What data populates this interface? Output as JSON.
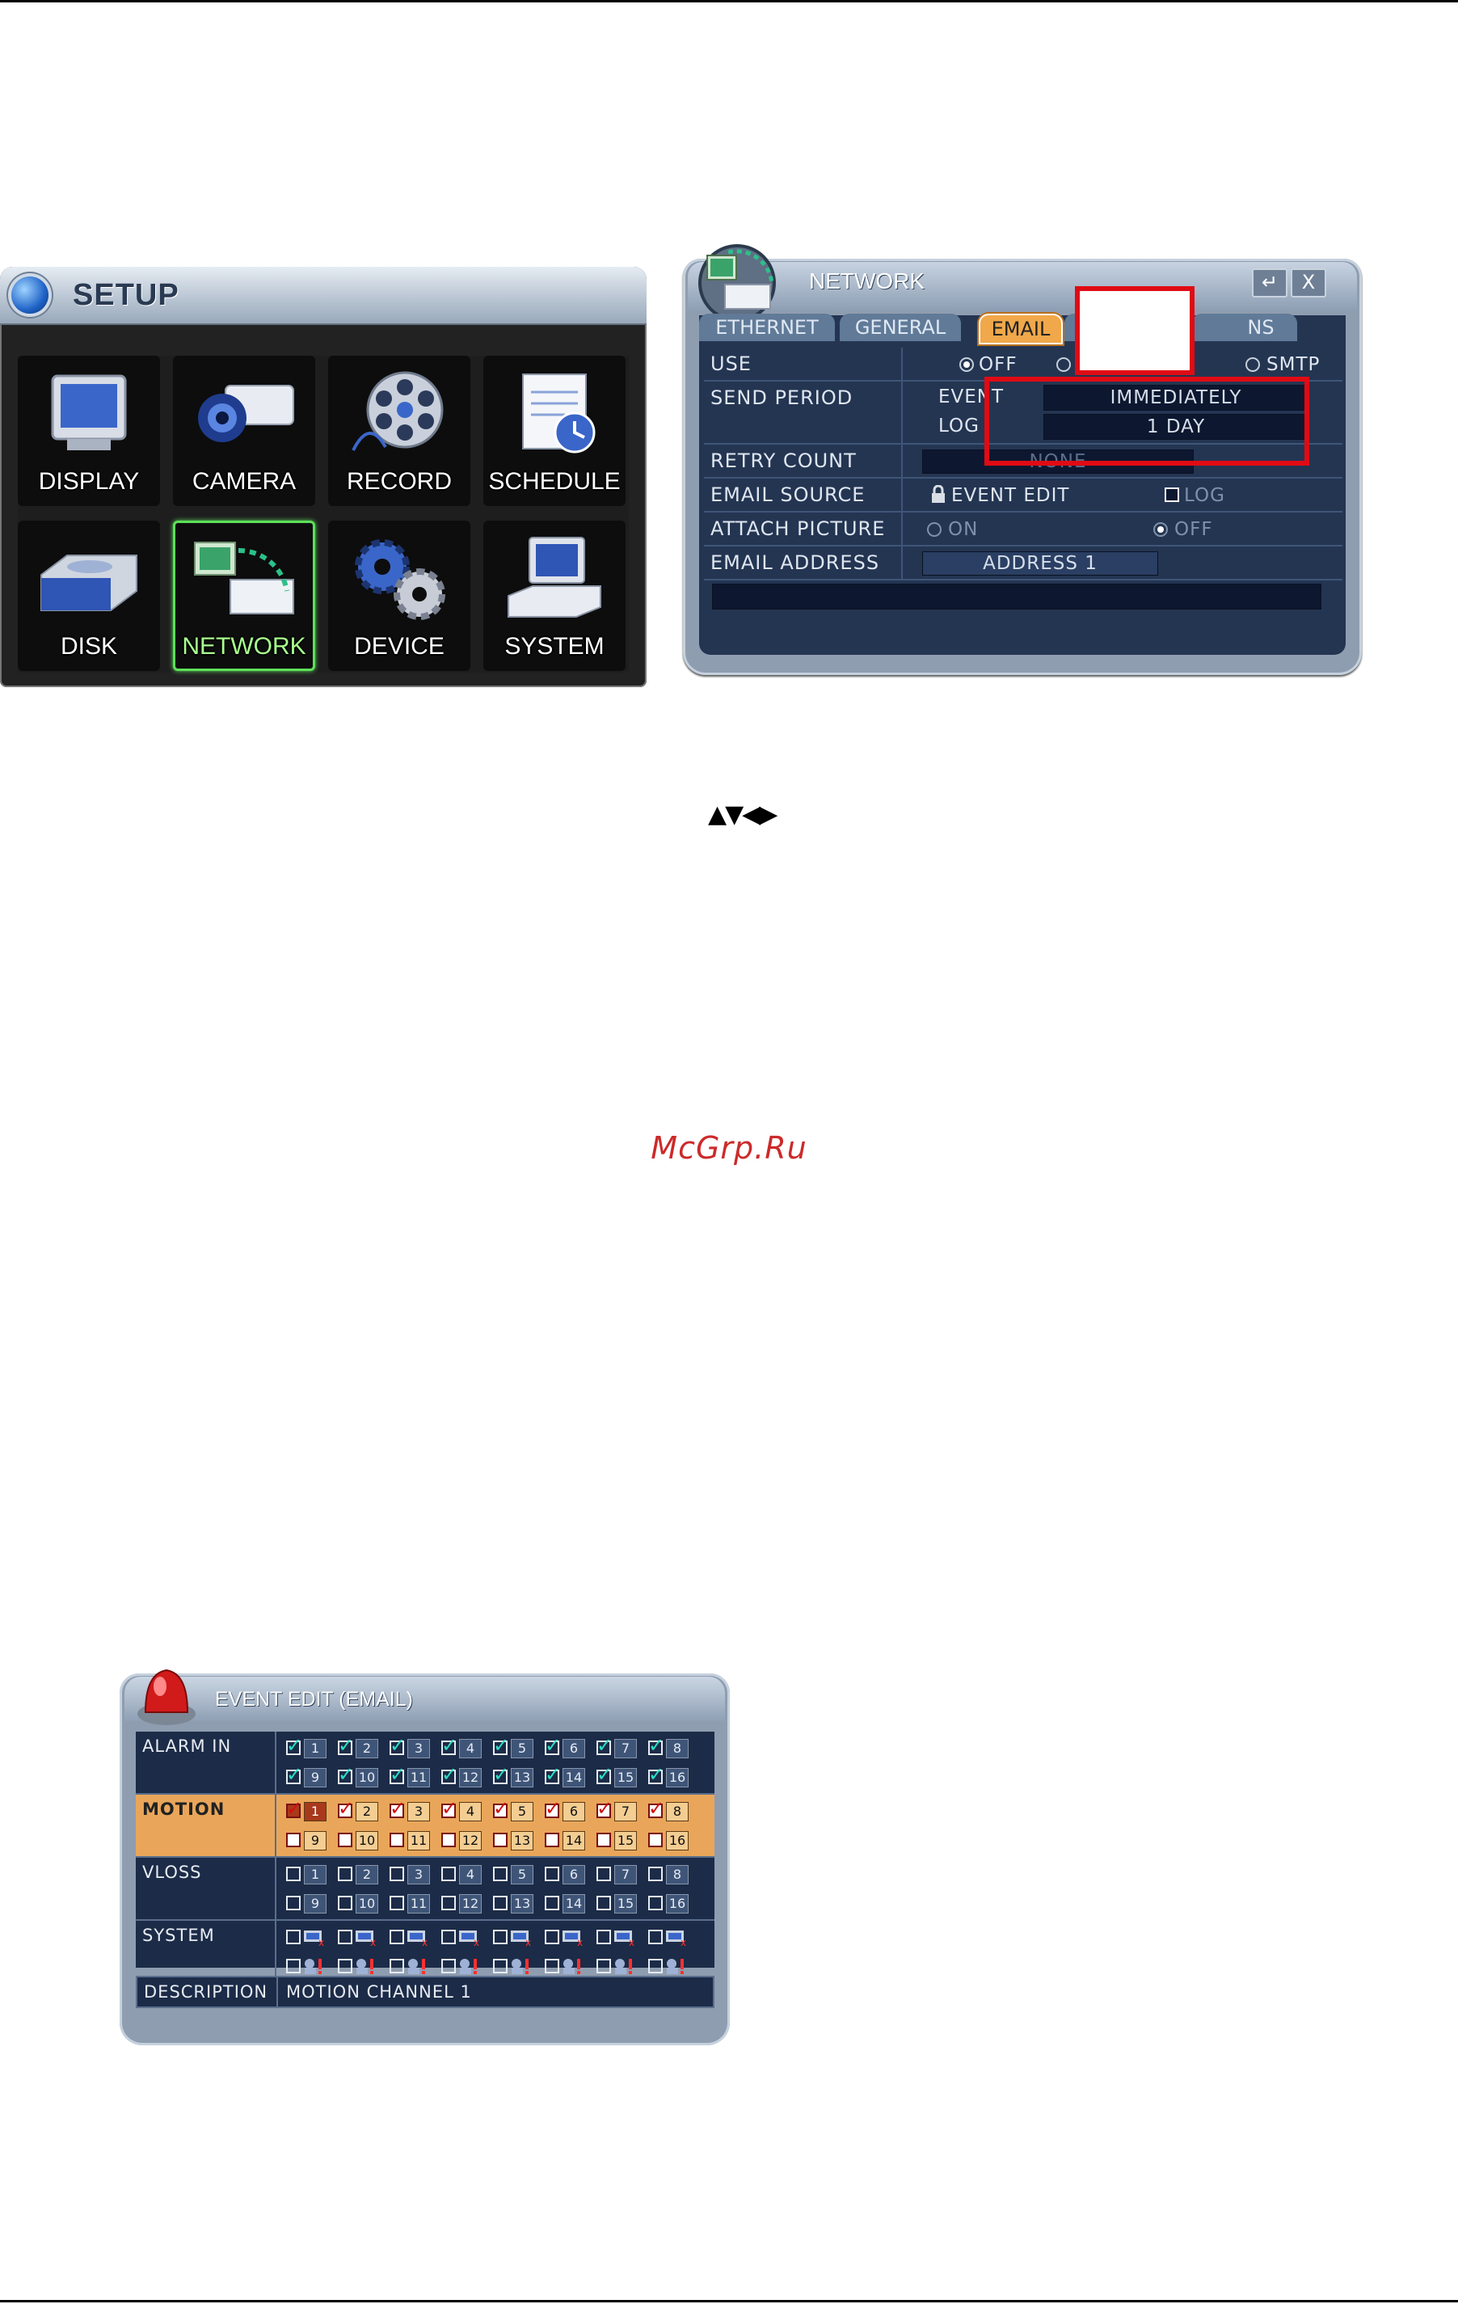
{
  "setup": {
    "title": "SETUP",
    "tiles": [
      {
        "label": "DISPLAY",
        "icon": "monitor-icon"
      },
      {
        "label": "CAMERA",
        "icon": "camera-icon"
      },
      {
        "label": "RECORD",
        "icon": "film-reel-icon"
      },
      {
        "label": "SCHEDULE",
        "icon": "notepad-clock-icon"
      },
      {
        "label": "DISK",
        "icon": "hard-disk-icon"
      },
      {
        "label": "NETWORK",
        "icon": "network-computers-icon",
        "selected": true
      },
      {
        "label": "DEVICE",
        "icon": "gears-icon"
      },
      {
        "label": "SYSTEM",
        "icon": "computer-icon"
      }
    ]
  },
  "network": {
    "title": "NETWORK",
    "tabs": [
      "ETHERNET",
      "GENERAL",
      "EMAIL",
      "NS"
    ],
    "active_tab": "EMAIL",
    "buttons": {
      "enter": "↵",
      "close": "X"
    },
    "use": {
      "label": "USE",
      "off": "OFF",
      "smtp": "SMTP"
    },
    "send_period": {
      "label": "SEND PERIOD",
      "event_label": "EVENT",
      "event_value": "IMMEDIATELY",
      "log_label": "LOG",
      "log_value": "1 DAY"
    },
    "retry_count": {
      "label": "RETRY COUNT",
      "value": "NONE"
    },
    "email_source": {
      "label": "EMAIL SOURCE",
      "event_edit": "EVENT EDIT",
      "log": "LOG"
    },
    "attach_picture": {
      "label": "ATTACH PICTURE",
      "on": "ON",
      "off": "OFF"
    },
    "email_address": {
      "label": "EMAIL ADDRESS",
      "value": "ADDRESS 1"
    }
  },
  "nav_arrows": "▲▼◀▶",
  "watermark": "McGrp.Ru",
  "event_edit": {
    "title": "EVENT EDIT (EMAIL)",
    "rows": [
      {
        "label": "ALARM IN"
      },
      {
        "label": "MOTION"
      },
      {
        "label": "VLOSS"
      },
      {
        "label": "SYSTEM"
      }
    ],
    "channels_row1": [
      "1",
      "2",
      "3",
      "4",
      "5",
      "6",
      "7",
      "8"
    ],
    "channels_row2": [
      "9",
      "10",
      "11",
      "12",
      "13",
      "14",
      "15",
      "16"
    ],
    "description_label": "DESCRIPTION",
    "description_value": "MOTION CHANNEL 1",
    "accent_colors": {
      "highlight": "#e9a65a",
      "check": "#2be0c4",
      "check_motion": "#d10f0f"
    }
  }
}
